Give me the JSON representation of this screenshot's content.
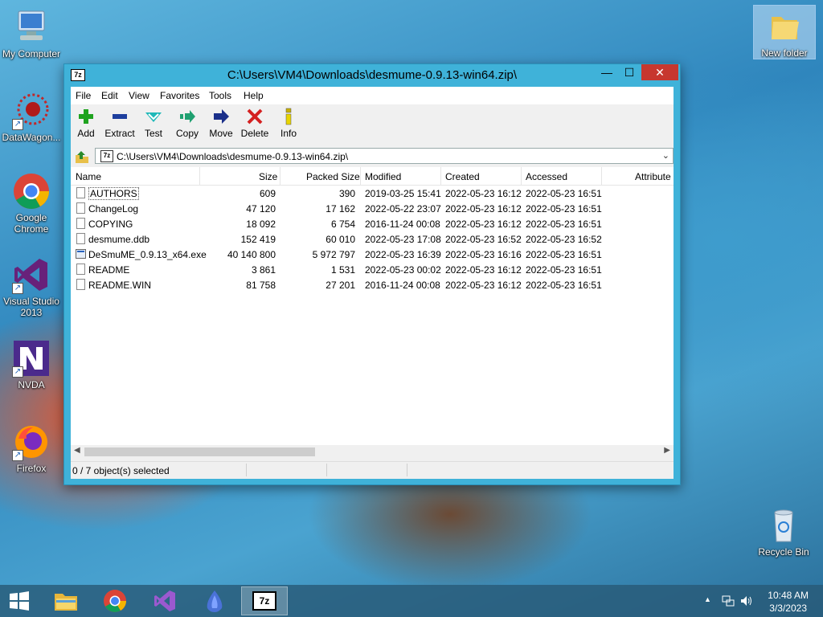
{
  "desktop": {
    "icons": [
      {
        "label": "My Computer"
      },
      {
        "label": "DataWagon..."
      },
      {
        "label": "Google Chrome"
      },
      {
        "label": "Visual Studio 2013"
      },
      {
        "label": "NVDA"
      },
      {
        "label": "Firefox"
      },
      {
        "label": "New folder"
      },
      {
        "label": "Recycle Bin"
      }
    ]
  },
  "window": {
    "title": "C:\\Users\\VM4\\Downloads\\desmume-0.9.13-win64.zip\\",
    "app_icon_text": "7z",
    "controls": {
      "minimize": "—",
      "maximize": "☐",
      "close": "✕"
    },
    "menu": [
      "File",
      "Edit",
      "View",
      "Favorites",
      "Tools",
      "Help"
    ],
    "toolbar": [
      {
        "label": "Add",
        "icon": "plus-icon",
        "color": "#1fa31f"
      },
      {
        "label": "Extract",
        "icon": "minus-icon",
        "color": "#1e3f9e"
      },
      {
        "label": "Test",
        "icon": "check-icon",
        "color": "#1fb8b8"
      },
      {
        "label": "Copy",
        "icon": "double-arrow-icon",
        "color": "#1fa070"
      },
      {
        "label": "Move",
        "icon": "arrow-right-icon",
        "color": "#1a2f8a"
      },
      {
        "label": "Delete",
        "icon": "x-icon",
        "color": "#d42020"
      },
      {
        "label": "Info",
        "icon": "info-icon",
        "color": "#c8b000"
      }
    ],
    "address": {
      "path": "C:\\Users\\VM4\\Downloads\\desmume-0.9.13-win64.zip\\"
    },
    "columns": [
      "Name",
      "Size",
      "Packed Size",
      "Modified",
      "Created",
      "Accessed",
      "Attribute"
    ],
    "files": [
      {
        "name": "AUTHORS",
        "size": "609",
        "packed": "390",
        "modified": "2019-03-25 15:41",
        "created": "2022-05-23 16:12",
        "accessed": "2022-05-23 16:51",
        "type": "file"
      },
      {
        "name": "ChangeLog",
        "size": "47 120",
        "packed": "17 162",
        "modified": "2022-05-22 23:07",
        "created": "2022-05-23 16:12",
        "accessed": "2022-05-23 16:51",
        "type": "file"
      },
      {
        "name": "COPYING",
        "size": "18 092",
        "packed": "6 754",
        "modified": "2016-11-24 00:08",
        "created": "2022-05-23 16:12",
        "accessed": "2022-05-23 16:51",
        "type": "file"
      },
      {
        "name": "desmume.ddb",
        "size": "152 419",
        "packed": "60 010",
        "modified": "2022-05-23 17:08",
        "created": "2022-05-23 16:52",
        "accessed": "2022-05-23 16:52",
        "type": "file"
      },
      {
        "name": "DeSmuME_0.9.13_x64.exe",
        "size": "40 140 800",
        "packed": "5 972 797",
        "modified": "2022-05-23 16:39",
        "created": "2022-05-23 16:16",
        "accessed": "2022-05-23 16:51",
        "type": "exe"
      },
      {
        "name": "README",
        "size": "3 861",
        "packed": "1 531",
        "modified": "2022-05-23 00:02",
        "created": "2022-05-23 16:12",
        "accessed": "2022-05-23 16:51",
        "type": "file"
      },
      {
        "name": "README.WIN",
        "size": "81 758",
        "packed": "27 201",
        "modified": "2016-11-24 00:08",
        "created": "2022-05-23 16:12",
        "accessed": "2022-05-23 16:51",
        "type": "file"
      }
    ],
    "status": "0 / 7 object(s) selected"
  },
  "taskbar": {
    "apps": [
      "start-button",
      "file-explorer",
      "chrome",
      "visual-studio",
      "nvda",
      "7zip"
    ],
    "clock": {
      "time": "10:48 AM",
      "date": "3/3/2023"
    }
  }
}
